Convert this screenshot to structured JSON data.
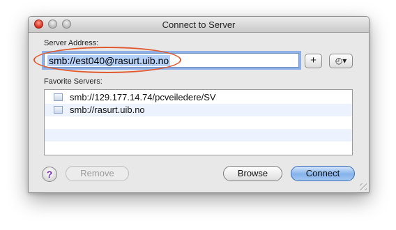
{
  "window": {
    "title": "Connect to Server"
  },
  "address": {
    "label": "Server Address:",
    "value": "smb://est040@rasurt.uib.no",
    "add_label": "+",
    "recent_label": "◴▾"
  },
  "favorites": {
    "label": "Favorite Servers:",
    "items": [
      {
        "text": "smb://129.177.14.74/pcveiledere/SV"
      },
      {
        "text": "smb://rasurt.uib.no"
      }
    ]
  },
  "buttons": {
    "help": "?",
    "remove": "Remove",
    "browse": "Browse",
    "connect": "Connect"
  },
  "colors": {
    "default_button": "#83b2ec",
    "annotation_oval": "#e05a30",
    "selection": "#b5d1f8"
  }
}
